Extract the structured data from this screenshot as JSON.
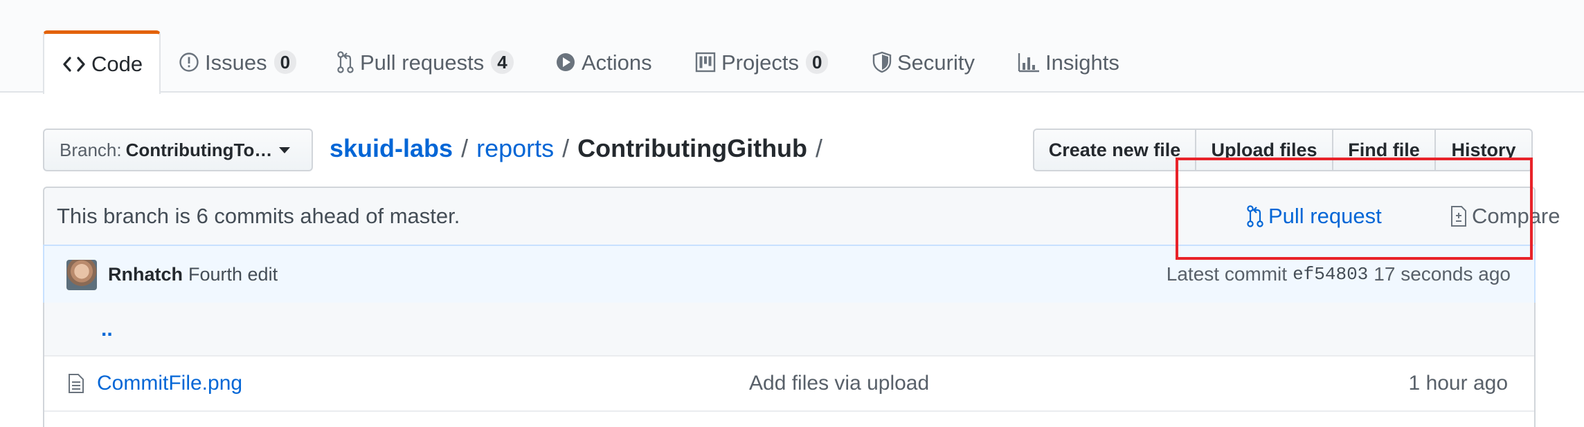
{
  "tabs": [
    {
      "label": "Code",
      "icon": "code-icon",
      "selected": true
    },
    {
      "label": "Issues",
      "icon": "issue-icon",
      "count": "0"
    },
    {
      "label": "Pull requests",
      "icon": "pull-request-icon",
      "count": "4"
    },
    {
      "label": "Actions",
      "icon": "play-icon"
    },
    {
      "label": "Projects",
      "icon": "project-icon",
      "count": "0"
    },
    {
      "label": "Security",
      "icon": "shield-icon"
    },
    {
      "label": "Insights",
      "icon": "graph-icon"
    }
  ],
  "branch_select": {
    "prefix": "Branch:",
    "name": "ContributingTo…"
  },
  "breadcrumb": {
    "owner": "skuid-labs",
    "repo": "reports",
    "folder": "ContributingGithub",
    "separator": "/"
  },
  "file_buttons": [
    "Create new file",
    "Upload files",
    "Find file",
    "History"
  ],
  "branch_info": {
    "message": "This branch is 6 commits ahead of master.",
    "pull_request_label": "Pull request",
    "compare_label": "Compare"
  },
  "latest_commit": {
    "author": "Rnhatch",
    "message": "Fourth edit",
    "prefix": "Latest commit",
    "sha": "ef54803",
    "age": "17 seconds ago"
  },
  "files": {
    "up_dir": "..",
    "rows": [
      {
        "name": "CommitFile.png",
        "message": "Add files via upload",
        "age": "1 hour ago"
      }
    ]
  },
  "colors": {
    "link": "#0366d6",
    "selected_tab_accent": "#e36209",
    "annotation": "#e8232a"
  }
}
